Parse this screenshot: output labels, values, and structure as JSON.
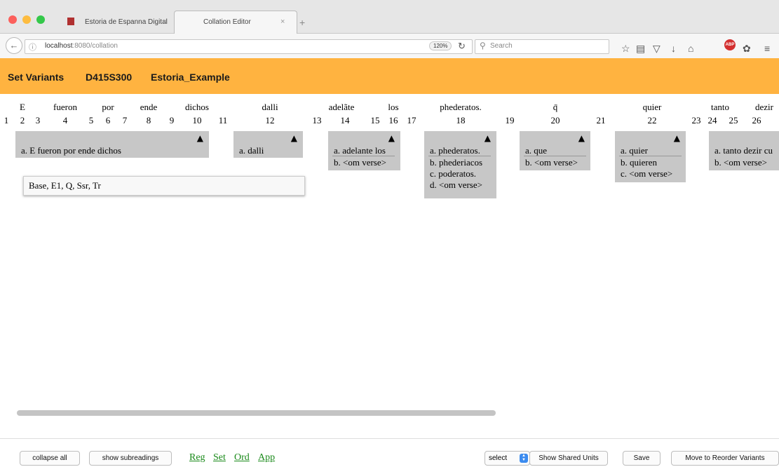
{
  "browser": {
    "tabs": [
      {
        "title": "Estoria de Espanna Digital",
        "close": "×"
      },
      {
        "title": "Collation Editor",
        "close": "×"
      }
    ],
    "new_tab": "+",
    "url_host": "localhost",
    "url_path": ":8080/collation",
    "zoom": "120%",
    "search_placeholder": "Search"
  },
  "colors": {
    "header_bg": "#ffb340",
    "variant_box": "#c7c7c7",
    "stage_link": "#1a8a1a"
  },
  "header": {
    "mode": "Set Variants",
    "unit": "D415S300",
    "project": "Estoria_Example"
  },
  "base_tokens": [
    {
      "text": "E"
    },
    {
      "text": "fueron"
    },
    {
      "text": "por"
    },
    {
      "text": "ende"
    },
    {
      "text": "dichos"
    },
    {
      "text": "dalli"
    },
    {
      "text": "adelãte"
    },
    {
      "text": "los"
    },
    {
      "text": "phederatos."
    },
    {
      "text": "q̄"
    },
    {
      "text": "quier"
    },
    {
      "text": "tanto"
    },
    {
      "text": "dezir"
    }
  ],
  "indices": [
    "1",
    "2",
    "3",
    "4",
    "5",
    "6",
    "7",
    "8",
    "9",
    "10",
    "11",
    "12",
    "13",
    "14",
    "15",
    "16",
    "17",
    "18",
    "19",
    "20",
    "21",
    "22",
    "23",
    "24",
    "25",
    "26"
  ],
  "variant_units": [
    {
      "readings": [
        "a. E fueron por ende dichos"
      ]
    },
    {
      "readings": [
        "a. dalli"
      ]
    },
    {
      "readings": [
        "a. adelante los",
        "b. <om verse>"
      ]
    },
    {
      "readings": [
        "a. phederatos.",
        "b. phederiacos",
        "c. poderatos.",
        "d. <om verse>"
      ]
    },
    {
      "readings": [
        "a. que",
        "b. <om verse>"
      ]
    },
    {
      "readings": [
        "a. quier",
        "b. quieren",
        "c. <om verse>"
      ]
    },
    {
      "readings": [
        "a. tanto dezir cu",
        "b. <om verse>"
      ]
    }
  ],
  "expand_symbol": "▲",
  "witness_popup": "Base, E1, Q, Ssr, Tr",
  "footer": {
    "collapse_all": "collapse all",
    "show_subreadings": "show subreadings",
    "stages": [
      "Reg",
      "Set",
      "Ord",
      "App"
    ],
    "select": "select",
    "show_shared_units": "Show Shared Units",
    "save": "Save",
    "move_to_reorder": "Move to Reorder Variants"
  }
}
